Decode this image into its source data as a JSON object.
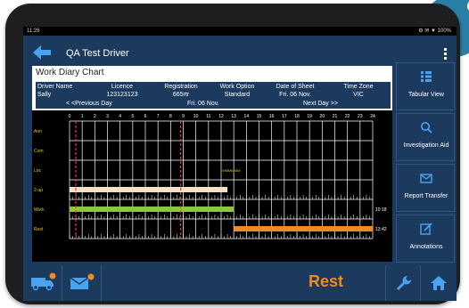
{
  "status_bar": {
    "time": "11:26",
    "right": "⚙ ✉ ▼ 100%"
  },
  "header": {
    "title": "QA Test Driver",
    "menu_icon": "kebab-icon",
    "back_icon": "arrow-left-icon"
  },
  "diary": {
    "heading": "Work Diary Chart",
    "columns": [
      {
        "label": "Driver Name",
        "value": "Sally"
      },
      {
        "label": "Licence",
        "value": "123123123"
      },
      {
        "label": "Registration",
        "value": "665rtr"
      },
      {
        "label": "Work Option",
        "value": "Standard"
      },
      {
        "label": "Date of Sheet",
        "value": "Fri. 06 Nov."
      },
      {
        "label": "Time Zone",
        "value": "VIC"
      }
    ],
    "nav": {
      "prev": "< <Previous Day",
      "date": "Fri. 06 Nov.",
      "next": "Next Day >>"
    }
  },
  "chart_data": {
    "type": "timeline",
    "hours": [
      "0",
      "1",
      "2",
      "3",
      "4",
      "5",
      "6",
      "7",
      "8",
      "9",
      "10",
      "11",
      "12",
      "13",
      "14",
      "15",
      "16",
      "17",
      "18",
      "19",
      "20",
      "21",
      "22",
      "23",
      "24"
    ],
    "rows": [
      "Ann",
      "Com",
      "Loc",
      "2-up",
      "Work",
      "Rest"
    ],
    "series": [
      {
        "row": "2-up",
        "start": 0,
        "end": 12.5,
        "color": "#f3e3c6"
      },
      {
        "row": "Work",
        "start": 0,
        "end": 13,
        "color": "#8dc63f"
      },
      {
        "row": "Rest",
        "start": 13,
        "end": 24,
        "color": "#f08a24"
      }
    ],
    "markers": [
      {
        "hour": 0.5
      },
      {
        "hour": 8.8
      }
    ],
    "labels": [
      {
        "row": "Loc",
        "hour": 12.1,
        "text": "MMMMMM"
      },
      {
        "row": "Work",
        "end_text": "10:18"
      },
      {
        "row": "Rest",
        "end_text": "13:42"
      }
    ],
    "colors": {
      "grid": "#ffffff",
      "row_label": "#f0c419",
      "marker": "#e53935"
    }
  },
  "sidebar": [
    {
      "label": "Tabular View",
      "icon": "list-icon"
    },
    {
      "label": "Investigation Aid",
      "icon": "search-icon"
    },
    {
      "label": "Report Transfer",
      "icon": "envelope-icon"
    },
    {
      "label": "Annotations",
      "icon": "edit-icon"
    }
  ],
  "bottom": {
    "rest_label": "Rest",
    "buttons": [
      {
        "name": "truck-button",
        "icon": "truck-icon"
      },
      {
        "name": "mail-button",
        "icon": "mail-icon"
      },
      {
        "name": "wrench-button",
        "icon": "wrench-icon"
      },
      {
        "name": "home-button",
        "icon": "home-icon"
      }
    ]
  },
  "colors": {
    "brand": "#1c3a5e",
    "accent": "#f08a24",
    "icon": "#4aa3f0"
  }
}
